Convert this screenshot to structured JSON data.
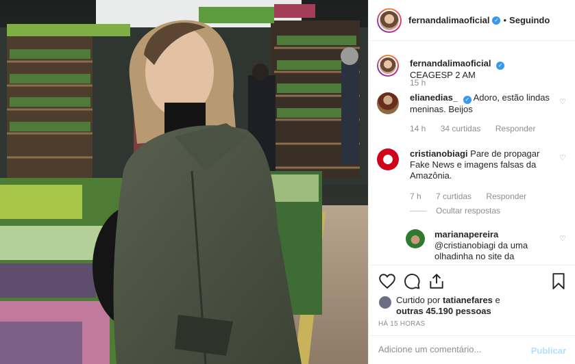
{
  "post": {
    "username": "fernandalimaoficial",
    "follow_status": "Seguindo",
    "separator": "•",
    "verified_mark": "✓"
  },
  "caption": {
    "username": "fernandalimaoficial",
    "text": "CEAGESP 2 AM",
    "time": "15 h"
  },
  "comments": [
    {
      "username": "elianedias_",
      "text": "Adoro, estão lindas meninas. Beijos",
      "time": "14 h",
      "likes": "34 curtidas",
      "reply": "Responder"
    },
    {
      "username": "cristianobiagi",
      "text": "Pare de propagar Fake News e imagens falsas da Amazônia.",
      "time": "7 h",
      "likes": "7 curtidas",
      "reply": "Responder",
      "hide_replies": "Ocultar respostas",
      "replies": [
        {
          "username": "marianapereira",
          "text": "@cristianobiagi da uma olhadinha no site da"
        }
      ]
    }
  ],
  "likes": {
    "prefix": "Curtido por",
    "user": "tatianefares",
    "connector": "e",
    "others": "outras 45.190 pessoas"
  },
  "timestamp": "HÁ 15 HORAS",
  "add_comment": {
    "placeholder": "Adicione um comentário...",
    "publish": "Publicar"
  },
  "colors": {
    "verified": "#3897f0",
    "publish_disabled": "#b2dffc",
    "meta": "#8e8e8e"
  }
}
